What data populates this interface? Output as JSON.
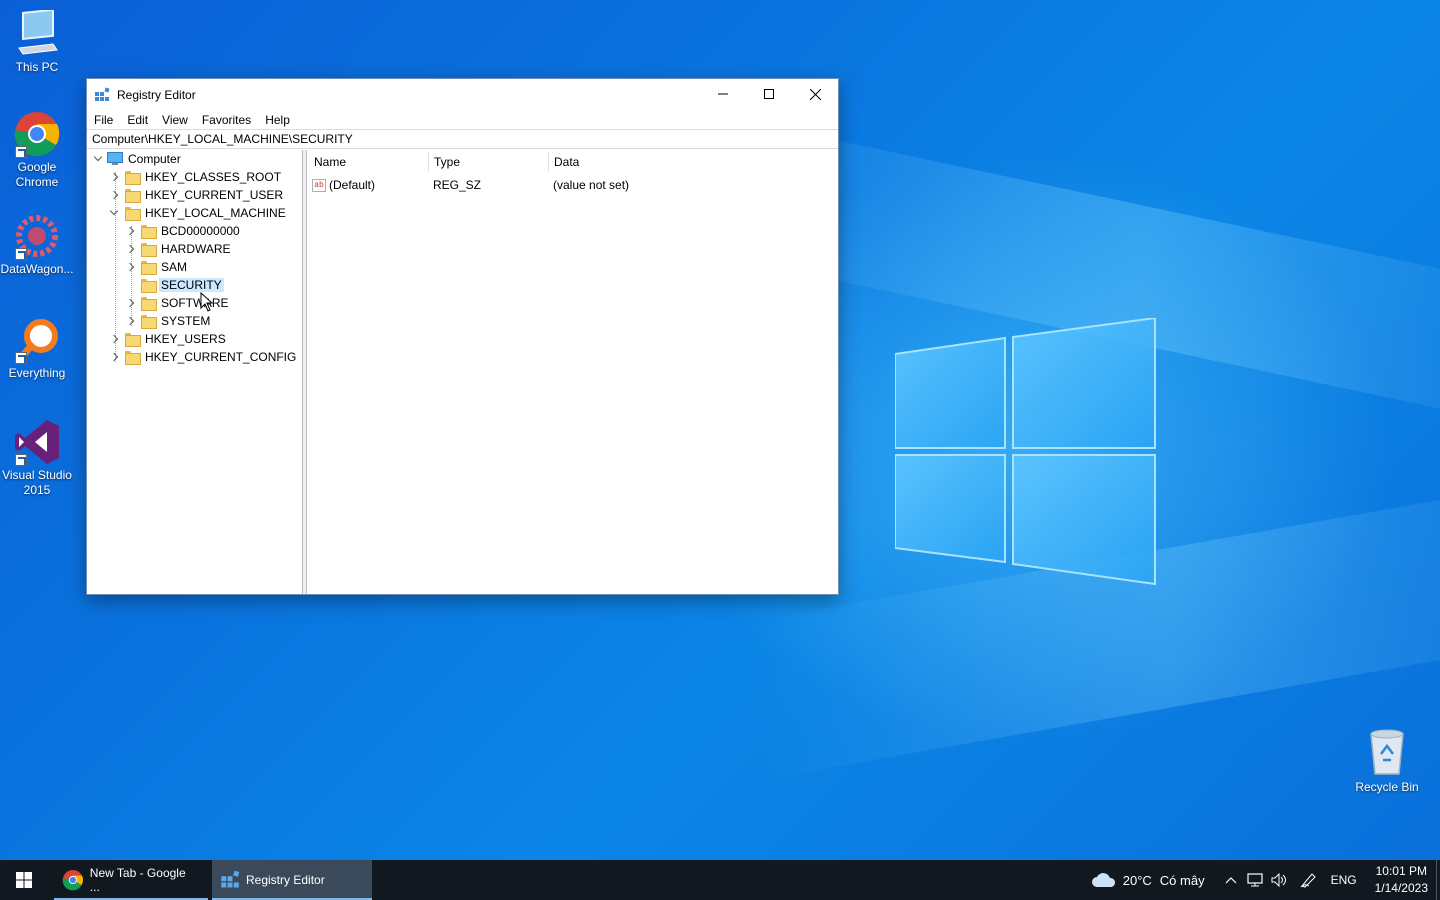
{
  "desktop": {
    "icons": [
      {
        "label": "This PC"
      },
      {
        "label": "Google Chrome"
      },
      {
        "label": "DataWagon..."
      },
      {
        "label": "Everything"
      },
      {
        "label": "Visual Studio 2015"
      }
    ],
    "recycle_bin": "Recycle Bin"
  },
  "window": {
    "title": "Registry Editor",
    "menu": [
      "File",
      "Edit",
      "View",
      "Favorites",
      "Help"
    ],
    "address": "Computer\\HKEY_LOCAL_MACHINE\\SECURITY",
    "tree": {
      "root": "Computer",
      "hives": [
        "HKEY_CLASSES_ROOT",
        "HKEY_CURRENT_USER",
        "HKEY_LOCAL_MACHINE",
        "HKEY_USERS",
        "HKEY_CURRENT_CONFIG"
      ],
      "hklm_children": [
        "BCD00000000",
        "HARDWARE",
        "SAM",
        "SECURITY",
        "SOFTWARE",
        "SYSTEM"
      ],
      "selected": "SECURITY"
    },
    "columns": {
      "name": "Name",
      "type": "Type",
      "data": "Data"
    },
    "values": [
      {
        "name": "(Default)",
        "type": "REG_SZ",
        "data": "(value not set)",
        "icon": "ab"
      }
    ]
  },
  "taskbar": {
    "items": [
      {
        "label": "New Tab - Google ...",
        "icon": "chrome-icon"
      },
      {
        "label": "Registry Editor",
        "icon": "regedit-icon"
      }
    ],
    "weather": {
      "temp": "20°C",
      "text": "Có mây"
    },
    "language": "ENG",
    "time": "10:01 PM",
    "date": "1/14/2023"
  },
  "colors": {
    "selection": "#cce8ff",
    "taskbar": "#111820",
    "accent": "#7fb6f0"
  }
}
